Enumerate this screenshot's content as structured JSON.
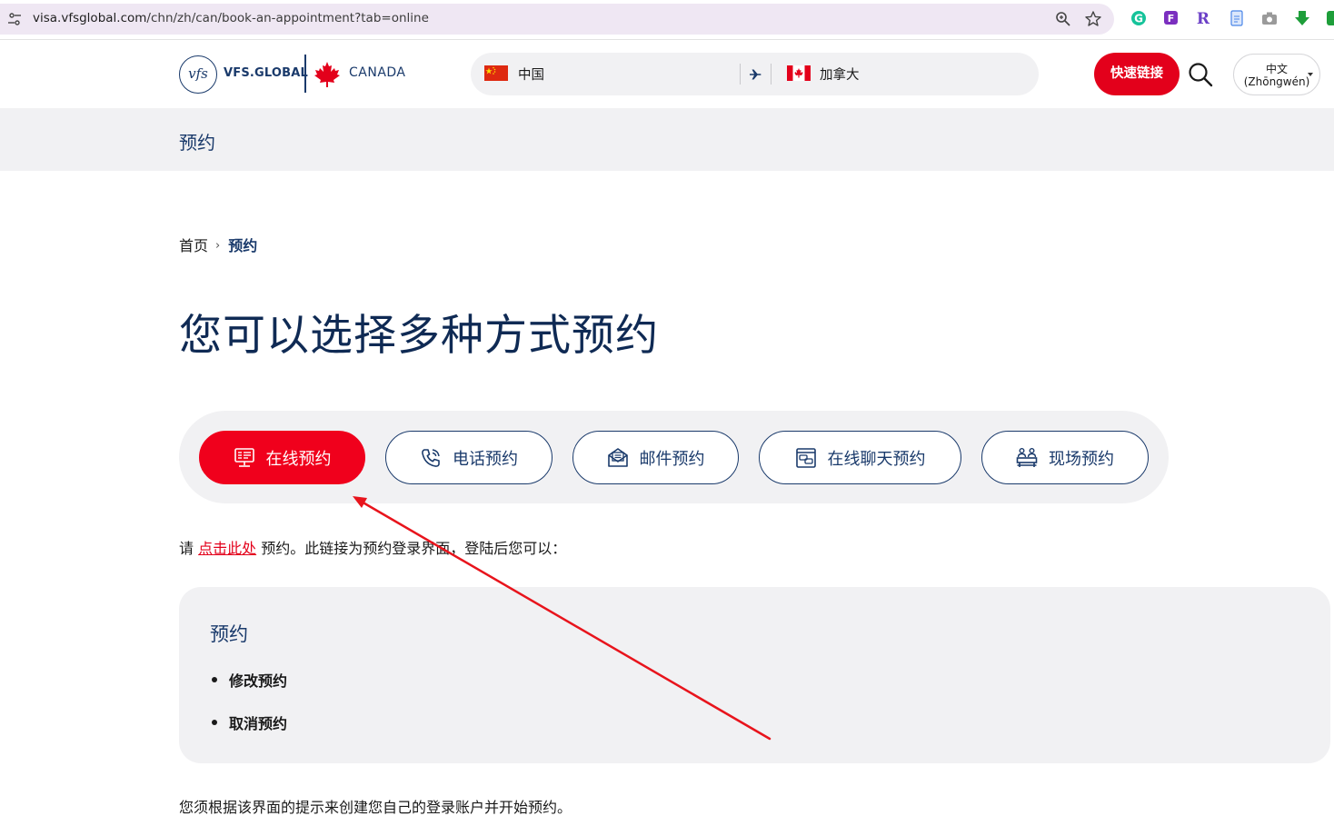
{
  "browser": {
    "url_host": "visa.vfsglobal.com",
    "url_path": "/chn/zh/can/book-an-appointment?tab=online"
  },
  "header": {
    "brand": "VFS.GLOBAL",
    "partner": "CANADA",
    "route": {
      "from": "中国",
      "to": "加拿大"
    },
    "quick_links": "快速链接",
    "language_line1": "中文",
    "language_line2": "(Zhōngwén)"
  },
  "banner": {
    "title": "预约"
  },
  "breadcrumb": {
    "home": "首页",
    "current": "预约"
  },
  "page_title": "您可以选择多种方式预约",
  "tabs": [
    {
      "label": "在线预约",
      "icon": "online-booking-icon",
      "active": true
    },
    {
      "label": "电话预约",
      "icon": "phone-icon",
      "active": false
    },
    {
      "label": "邮件预约",
      "icon": "mail-icon",
      "active": false
    },
    {
      "label": "在线聊天预约",
      "icon": "chat-icon",
      "active": false
    },
    {
      "label": "现场预约",
      "icon": "walk-in-icon",
      "active": false
    }
  ],
  "intro": {
    "prefix": "请 ",
    "link": "点击此处",
    "suffix": " 预约。此链接为预约登录界面，登陆后您可以："
  },
  "card": {
    "title": "预约",
    "items": [
      "修改预约",
      "取消预约"
    ]
  },
  "footer_text": "您须根据该界面的提示来创建您自己的登录账户并开始预约。",
  "colors": {
    "brand_navy": "#1a3a6b",
    "brand_red": "#e3001b",
    "surface": "#f1f1f3",
    "annotation_arrow": "#e8141c"
  }
}
